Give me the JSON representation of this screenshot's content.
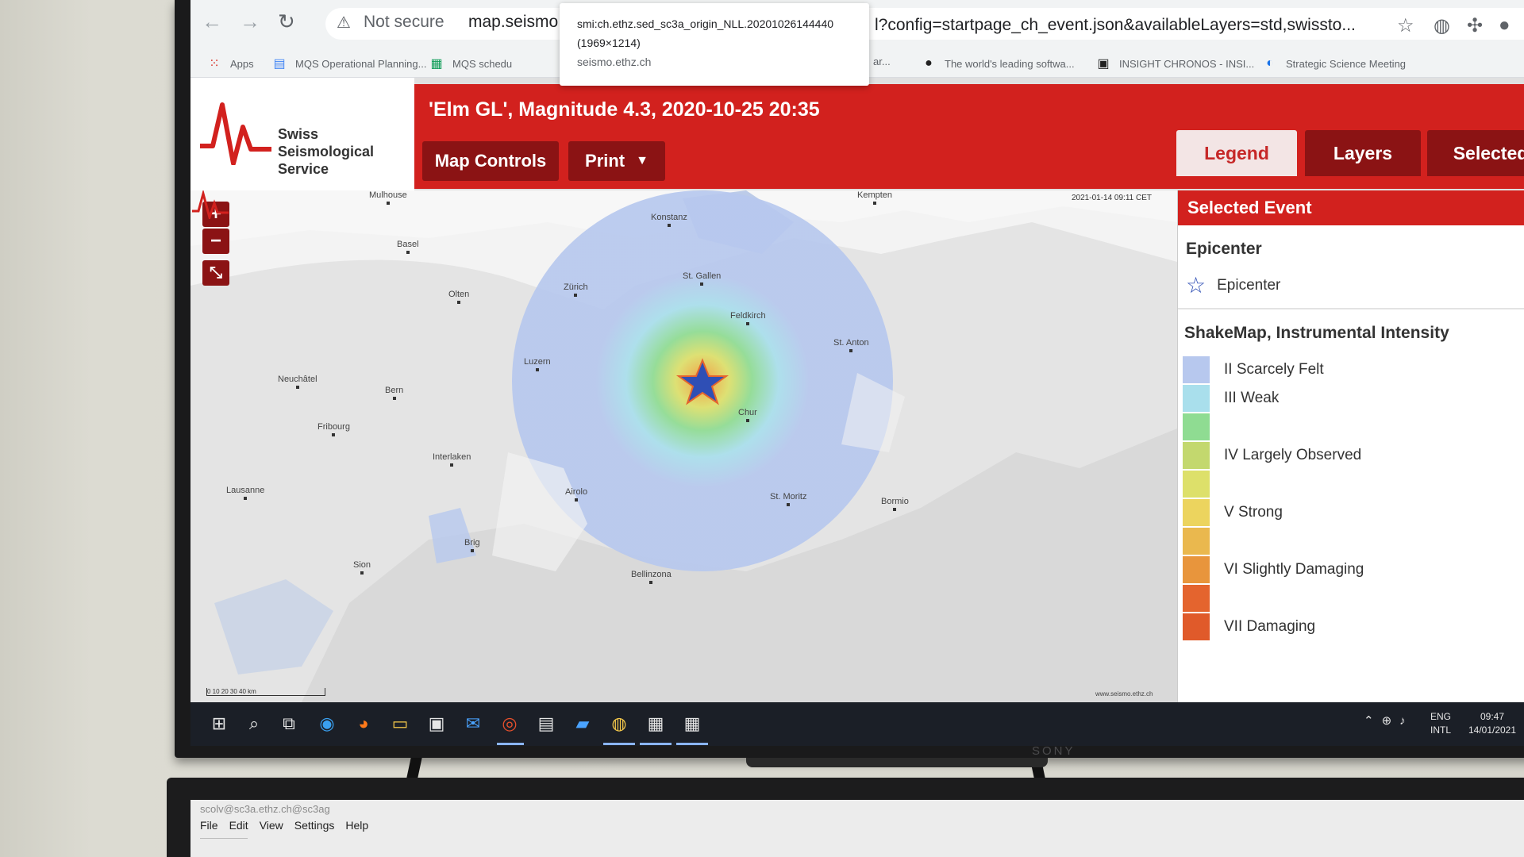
{
  "browser": {
    "url_warning": "Not secure",
    "url_host": "map.seismo.",
    "url_rest": "l?config=startpage_ch_event.json&availableLayers=std,swissto...",
    "tooltip": {
      "title": "smi:ch.ethz.sed_sc3a_origin_NLL.20201026144440",
      "size": "(1969×1214)",
      "domain": "seismo.ethz.ch"
    },
    "bookmarks": [
      {
        "label": "Apps",
        "icon": "apps-grid-icon"
      },
      {
        "label": "MQS Operational Planning...",
        "icon": "docs-icon"
      },
      {
        "label": "MQS schedu",
        "icon": "sheets-icon"
      },
      {
        "label": "ar...",
        "icon": "bookmark-icon"
      },
      {
        "label": "The world's leading softwa...",
        "icon": "github-icon"
      },
      {
        "label": "INSIGHT CHRONOS - INSI...",
        "icon": "chronos-icon"
      },
      {
        "label": "Strategic Science Meeting",
        "icon": "meeting-icon"
      }
    ]
  },
  "app": {
    "logo_line1": "Swiss Seismological",
    "logo_line2": "Service",
    "event_title": "'Elm GL', Magnitude 4.3, 2020-10-25 20:35",
    "map_controls_label": "Map Controls",
    "print_label": "Print",
    "tabs": [
      {
        "label": "Legend",
        "active": true
      },
      {
        "label": "Layers",
        "active": false
      },
      {
        "label": "Selected",
        "active": false
      }
    ]
  },
  "map": {
    "timestamp": "2021-01-14 09:11 CET",
    "zoom_in": "+",
    "zoom_out": "−",
    "scale_label": "0  10  20  30  40 km",
    "footer_url": "www.seismo.ethz.ch",
    "cities": [
      "Mulhouse",
      "Konstanz",
      "Kempten",
      "Basel",
      "Zürich",
      "St. Gallen",
      "Olten",
      "Feldkirch",
      "St. Anton",
      "Luzern",
      "Neuchâtel",
      "Bern",
      "Chur",
      "Fribourg",
      "Interlaken",
      "Lausanne",
      "Airolo",
      "St. Moritz",
      "Bormio",
      "Brig",
      "Sion",
      "Bellinzona"
    ]
  },
  "panel": {
    "header": "Selected Event",
    "epicenter_heading": "Epicenter",
    "epicenter_label": "Epicenter",
    "shakemap_heading": "ShakeMap, Instrumental Intensity",
    "legend": [
      {
        "label": "II Scarcely Felt",
        "color": "#b7c8ee"
      },
      {
        "label": "III Weak",
        "color": "#a9dfec"
      },
      {
        "label": "",
        "color": "#8fdc92"
      },
      {
        "label": "IV Largely Observed",
        "color": "#c3d86e"
      },
      {
        "label": "",
        "color": "#dde06a"
      },
      {
        "label": "V Strong",
        "color": "#ecd45e"
      },
      {
        "label": "",
        "color": "#eab84e"
      },
      {
        "label": "VI Slightly Damaging",
        "color": "#e8953c"
      },
      {
        "label": "",
        "color": "#e4642e"
      },
      {
        "label": "VII Damaging",
        "color": "#e05a2a"
      }
    ]
  },
  "taskbar": {
    "lang1": "ENG",
    "lang2": "INTL",
    "time": "09:47",
    "date": "14/01/2021"
  },
  "monitor2": {
    "title": "scolv@sc3a.ethz.ch@sc3ag",
    "menu": [
      "File",
      "Edit",
      "View",
      "Settings",
      "Help"
    ]
  },
  "tv_brand": "SONY",
  "colors": {
    "brand_red": "#d2211e",
    "dark_red": "#8b1314",
    "epicenter_star": "#2f4fb5"
  }
}
